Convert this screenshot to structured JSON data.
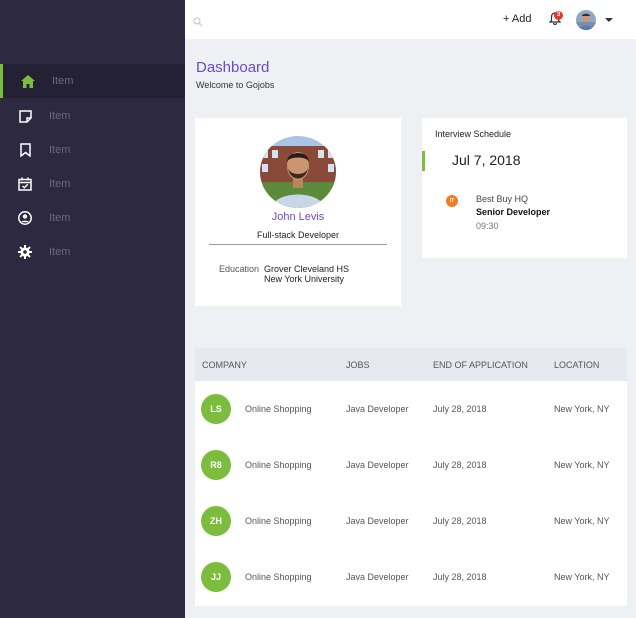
{
  "sidebar": {
    "items": [
      {
        "label": "Item",
        "icon": "home-icon",
        "active": true
      },
      {
        "label": "Item",
        "icon": "note-icon"
      },
      {
        "label": "Item",
        "icon": "bookmark-icon"
      },
      {
        "label": "Item",
        "icon": "calendar-check-icon"
      },
      {
        "label": "Item",
        "icon": "user-circle-icon"
      },
      {
        "label": "Item",
        "icon": "gear-icon"
      }
    ]
  },
  "topbar": {
    "add_label": "+ Add",
    "notification_count": "3"
  },
  "header": {
    "title": "Dashboard",
    "subtitle": "Welcome to Gojobs"
  },
  "profile": {
    "name": "John Levis",
    "role": "Full-stack Developer",
    "education_label": "Education",
    "education": [
      "Grover Cleveland HS",
      "New York University"
    ]
  },
  "interview": {
    "title": "Interview Schedule",
    "date": "Jul 7, 2018",
    "badge": "IT",
    "company": "Best Buy HQ",
    "position": "Senior Developer",
    "time": "09:30"
  },
  "table": {
    "headers": [
      "COMPANY",
      "JOBS",
      "END OF APPLICATION",
      "LOCATION"
    ],
    "rows": [
      {
        "initials": "LS",
        "company": "Online Shopping",
        "job": "Java Developer",
        "end": "July 28, 2018",
        "location": "New York, NY"
      },
      {
        "initials": "R8",
        "company": "Online Shopping",
        "job": "Java Developer",
        "end": "July 28, 2018",
        "location": "New York, NY"
      },
      {
        "initials": "ZH",
        "company": "Online Shopping",
        "job": "Java Developer",
        "end": "July 28, 2018",
        "location": "New York, NY"
      },
      {
        "initials": "JJ",
        "company": "Online Shopping",
        "job": "Java Developer",
        "end": "July 28, 2018",
        "location": "New York, NY"
      }
    ]
  },
  "colors": {
    "sidebar": "#2c2940",
    "accent_green": "#7cbd3d",
    "accent_purple": "#6a4bc4",
    "orange": "#f07b22"
  }
}
